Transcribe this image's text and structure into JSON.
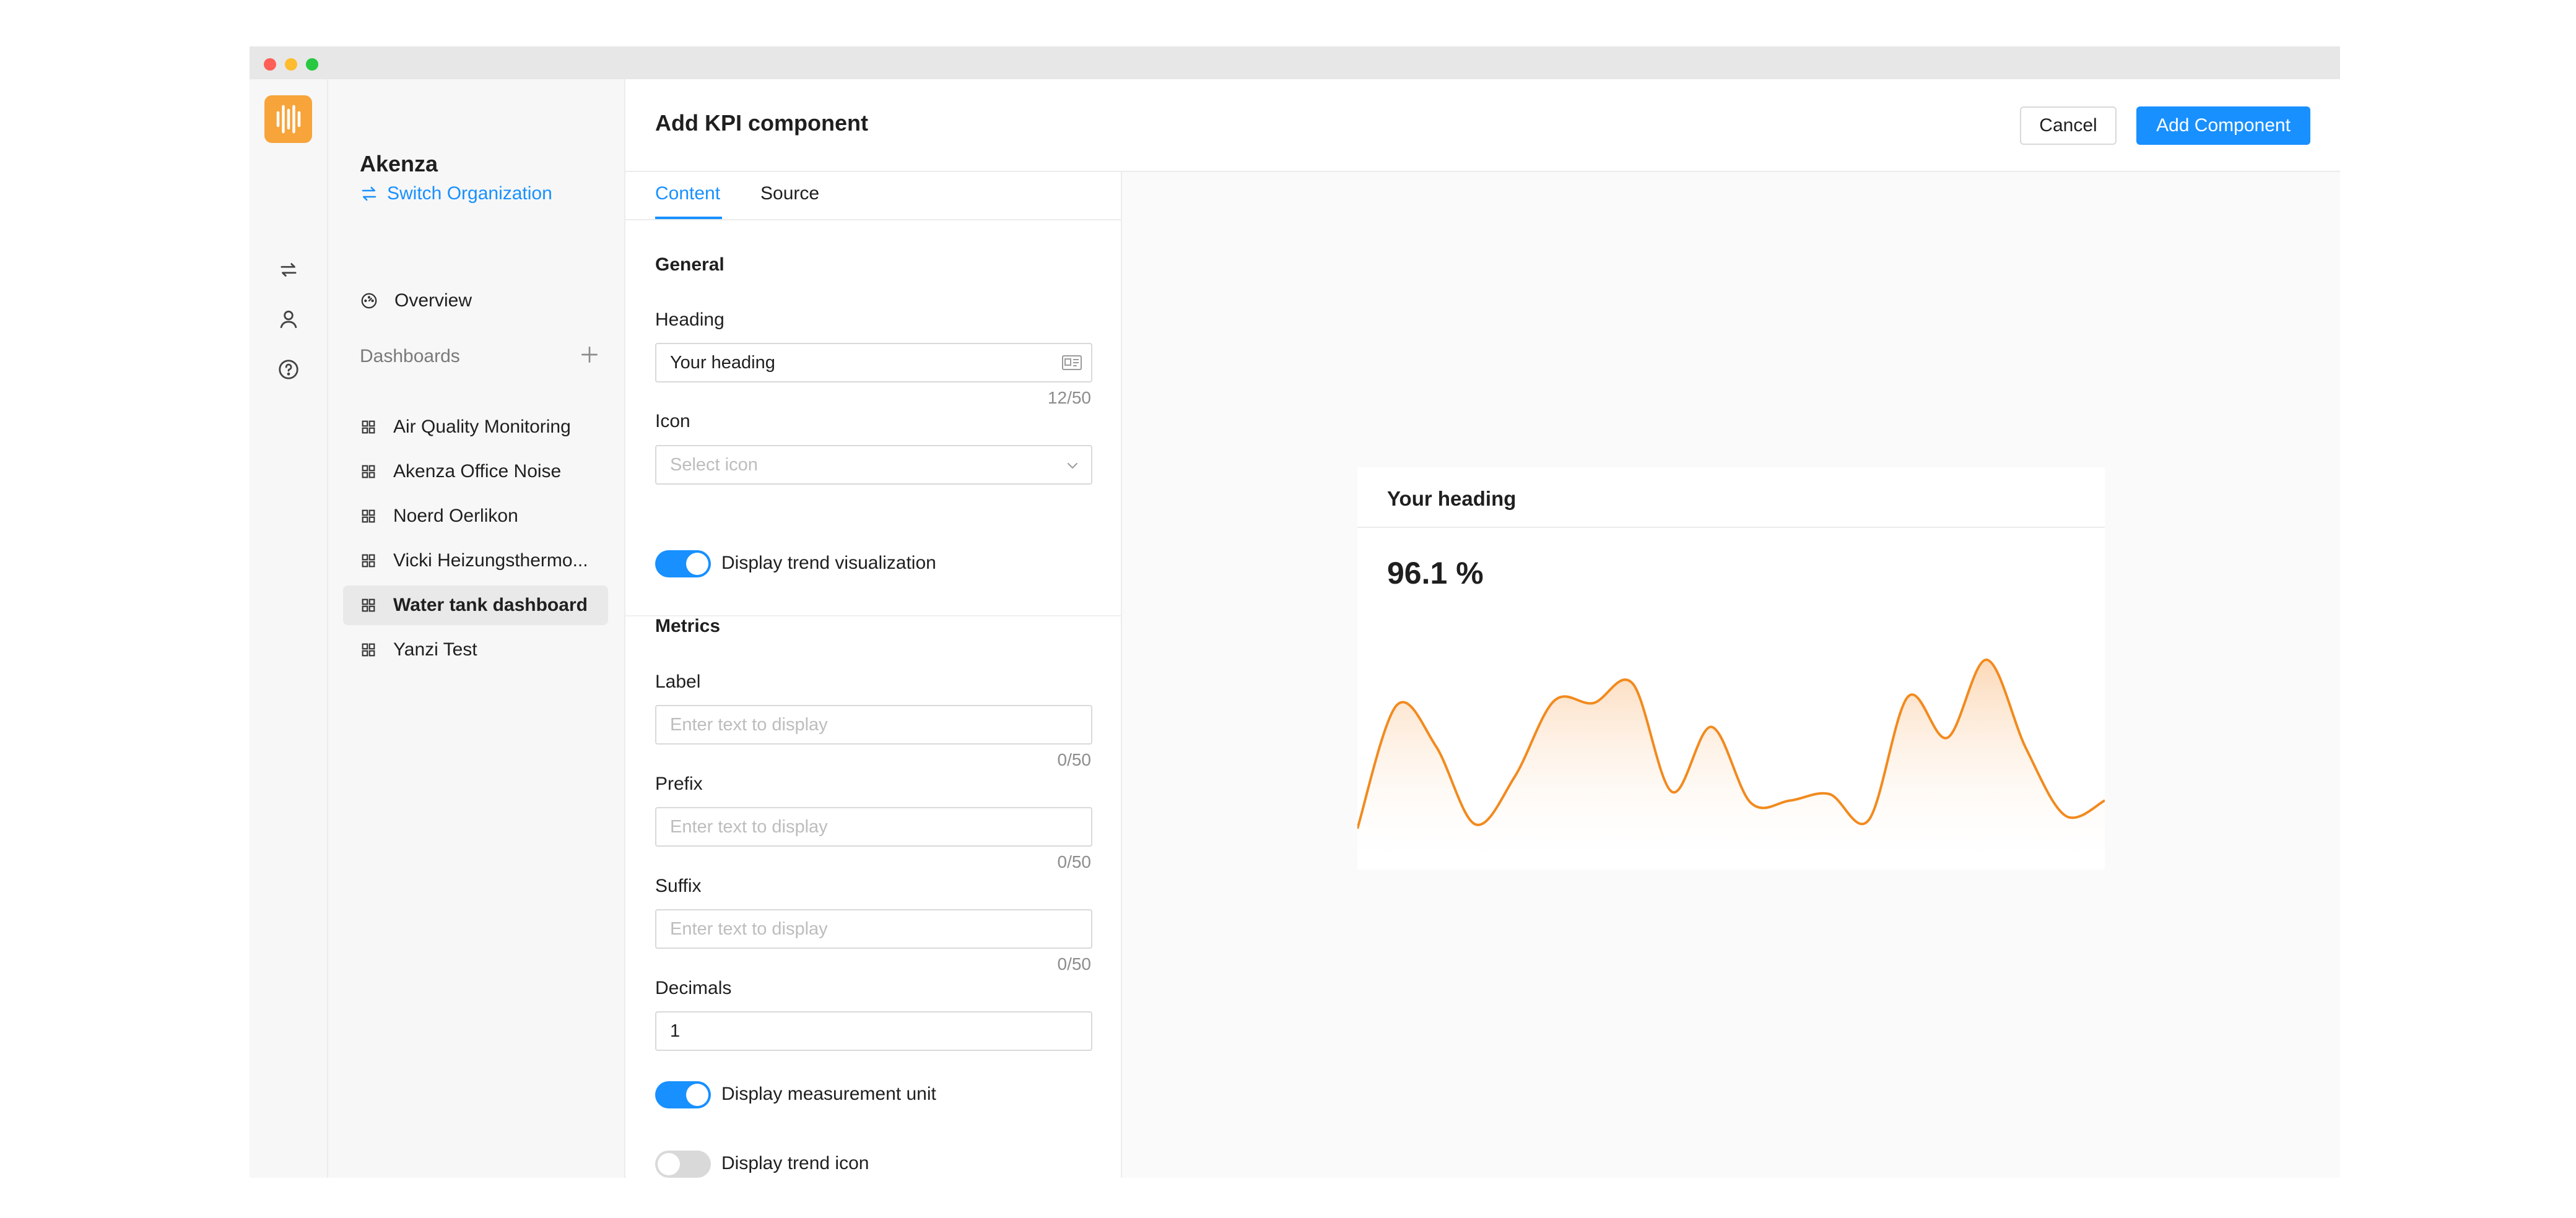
{
  "sidebar": {
    "org_name": "Akenza",
    "switch_org": "Switch Organization",
    "overview": "Overview",
    "dashboards_label": "Dashboards",
    "dashboards": [
      {
        "label": "Air Quality Monitoring",
        "active": false
      },
      {
        "label": "Akenza Office Noise",
        "active": false
      },
      {
        "label": "Noerd Oerlikon",
        "active": false
      },
      {
        "label": "Vicki Heizungsthermo...",
        "active": false
      },
      {
        "label": "Water tank dashboard",
        "active": true
      },
      {
        "label": "Yanzi Test",
        "active": false
      }
    ]
  },
  "header": {
    "title": "Add KPI component",
    "cancel_label": "Cancel",
    "add_label": "Add Component"
  },
  "tabs": [
    "Content",
    "Source"
  ],
  "form": {
    "general_title": "General",
    "heading_label": "Heading",
    "heading_value": "Your heading",
    "heading_counter": "12/50",
    "icon_label": "Icon",
    "icon_placeholder": "Select icon",
    "trend_toggle_label": "Display trend visualization",
    "trend_toggle_on": true,
    "metrics_title": "Metrics",
    "label_label": "Label",
    "label_placeholder": "Enter text to display",
    "label_counter": "0/50",
    "prefix_label": "Prefix",
    "prefix_placeholder": "Enter text to display",
    "prefix_counter": "0/50",
    "suffix_label": "Suffix",
    "suffix_placeholder": "Enter text to display",
    "suffix_counter": "0/50",
    "decimals_label": "Decimals",
    "decimals_value": "1",
    "unit_toggle_label": "Display measurement unit",
    "unit_toggle_on": true,
    "trend_icon_toggle_label": "Display trend icon",
    "trend_icon_toggle_on": false
  },
  "preview": {
    "heading": "Your heading",
    "value": "96.1 %"
  },
  "chart_data": {
    "type": "area",
    "values": [
      0.04,
      0.61,
      0.42,
      0.06,
      0.28,
      0.63,
      0.62,
      0.71,
      0.21,
      0.51,
      0.16,
      0.17,
      0.2,
      0.08,
      0.65,
      0.46,
      0.82,
      0.41,
      0.1,
      0.17
    ],
    "ylim": [
      0,
      1
    ],
    "line_color": "#f28a1e",
    "fill_color": "#fbd2ab"
  },
  "colors": {
    "accent": "#1890ff",
    "logo": "#f7a43b"
  }
}
